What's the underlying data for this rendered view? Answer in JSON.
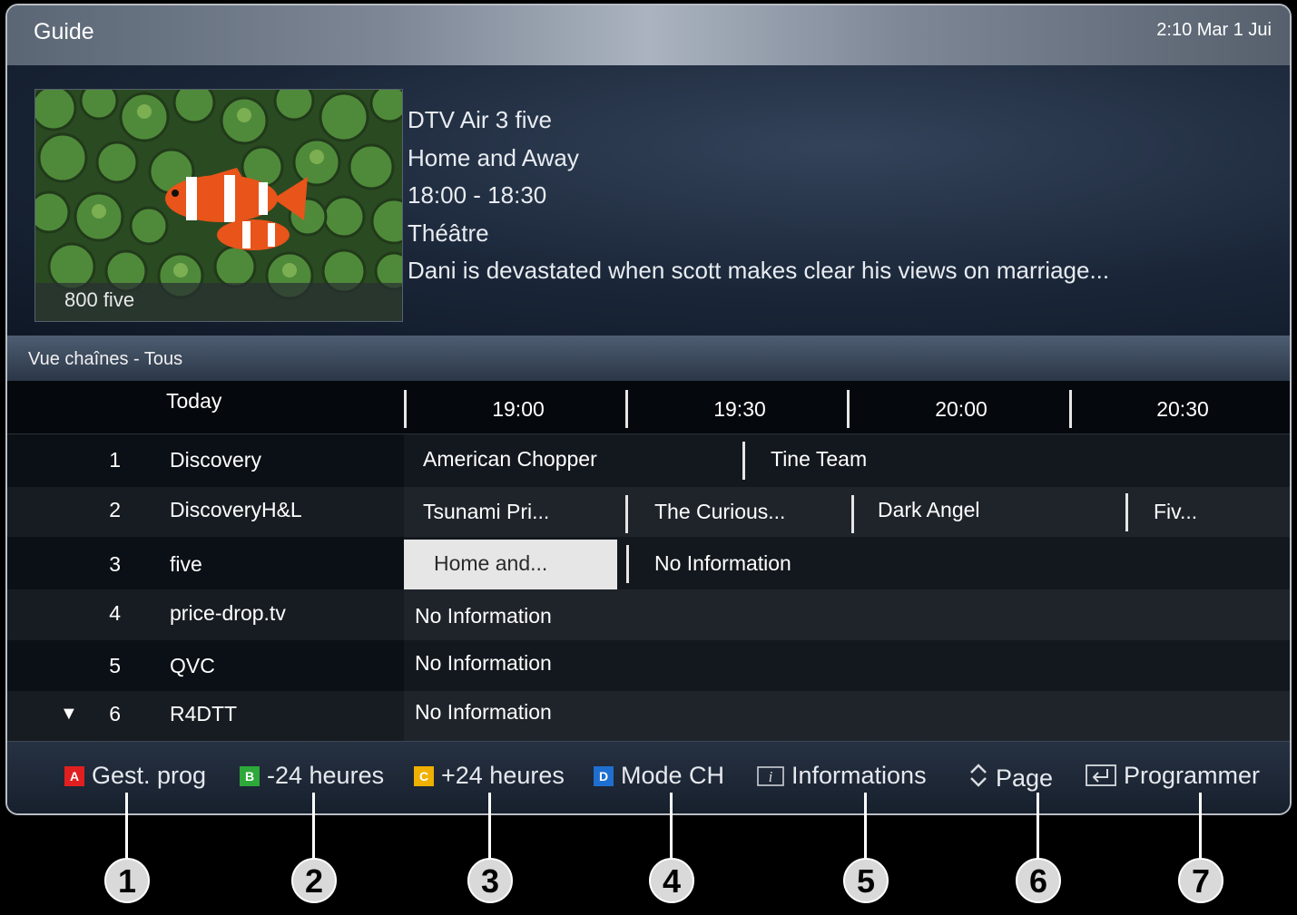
{
  "header": {
    "title": "Guide",
    "clock": "2:10 Mar 1 Jui"
  },
  "preview": {
    "channel_overlay": "800 five",
    "details": [
      "DTV Air 3 five",
      "Home and Away",
      "18:00 - 18:30",
      "Théâtre",
      "Dani is devastated when scott makes clear his views on marriage..."
    ]
  },
  "section": {
    "label": "Vue chaînes - Tous"
  },
  "timebar": {
    "today": "Today",
    "times": [
      "19:00",
      "19:30",
      "20:00",
      "20:30"
    ]
  },
  "channels": [
    {
      "num": "1",
      "name": "Discovery",
      "programs": [
        "American Chopper",
        "Tine Team"
      ]
    },
    {
      "num": "2",
      "name": "DiscoveryH&L",
      "programs": [
        "Tsunami Pri...",
        "The Curious...",
        "Dark Angel",
        "Fiv..."
      ]
    },
    {
      "num": "3",
      "name": "five",
      "programs": [
        "Home and...",
        "No Information"
      ]
    },
    {
      "num": "4",
      "name": "price-drop.tv",
      "programs": [
        "No Information"
      ]
    },
    {
      "num": "5",
      "name": "QVC",
      "programs": [
        "No Information"
      ]
    },
    {
      "num": "6",
      "name": "R4DTT",
      "programs": [
        "No Information"
      ],
      "arrow": "▼"
    }
  ],
  "footer": {
    "items": [
      {
        "badge": "A",
        "color": "#e02020",
        "label": "Gest. prog"
      },
      {
        "badge": "B",
        "color": "#2ea83a",
        "label": "-24 heures"
      },
      {
        "badge": "C",
        "color": "#f0b000",
        "label": "+24 heures"
      },
      {
        "badge": "D",
        "color": "#1f6fd0",
        "label": "Mode CH"
      },
      {
        "icon": "info-icon",
        "label": "Informations"
      },
      {
        "icon": "updown-icon",
        "label": "Page"
      },
      {
        "icon": "enter-icon",
        "label": "Programmer"
      }
    ]
  },
  "callouts": [
    "1",
    "2",
    "3",
    "4",
    "5",
    "6",
    "7"
  ]
}
